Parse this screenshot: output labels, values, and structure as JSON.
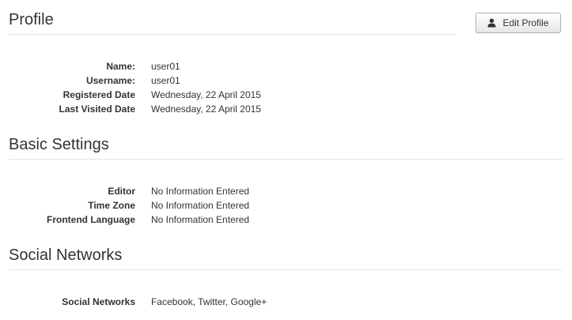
{
  "profile": {
    "title": "Profile",
    "edit_button_label": "Edit Profile",
    "edit_button_icon": "user-icon",
    "fields": [
      {
        "label": "Name:",
        "value": "user01"
      },
      {
        "label": "Username:",
        "value": "user01"
      },
      {
        "label": "Registered Date",
        "value": "Wednesday, 22 April 2015"
      },
      {
        "label": "Last Visited Date",
        "value": "Wednesday, 22 April 2015"
      }
    ]
  },
  "basic_settings": {
    "title": "Basic Settings",
    "fields": [
      {
        "label": "Editor",
        "value": "No Information Entered"
      },
      {
        "label": "Time Zone",
        "value": "No Information Entered"
      },
      {
        "label": "Frontend Language",
        "value": "No Information Entered"
      }
    ]
  },
  "social_networks": {
    "title": "Social Networks",
    "fields": [
      {
        "label": "Social Networks",
        "value": "Facebook, Twitter, Google+"
      }
    ]
  }
}
